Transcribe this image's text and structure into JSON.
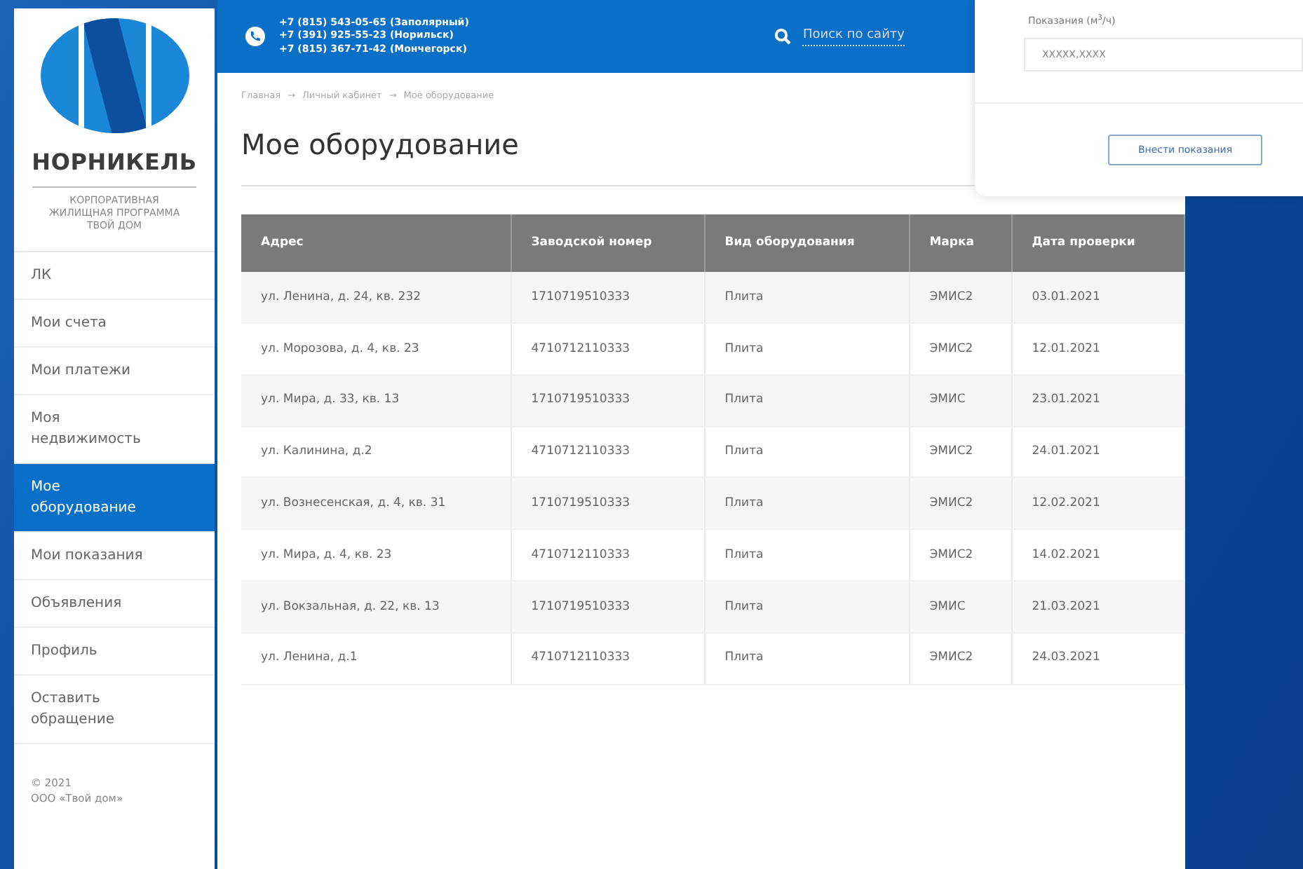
{
  "sidebar": {
    "brand": "НОРНИКЕЛЬ",
    "tagline": "КОРПОРАТИВНАЯ ЖИЛИЩНАЯ ПРОГРАММА ТВОЙ ДОМ",
    "items": [
      {
        "label": "ЛК",
        "selected": false
      },
      {
        "label": "Мои счета",
        "selected": false
      },
      {
        "label": "Мои платежи",
        "selected": false
      },
      {
        "label": "Моя недвижимость",
        "selected": false
      },
      {
        "label": "Мое оборудование",
        "selected": true
      },
      {
        "label": "Мои показания",
        "selected": false
      },
      {
        "label": "Объявления",
        "selected": false
      },
      {
        "label": "Профиль",
        "selected": false
      },
      {
        "label": "Оставить обращение",
        "selected": false
      }
    ],
    "footer": [
      "© 2021",
      "ООО «Твой дом»"
    ]
  },
  "header": {
    "phones": [
      "+7 (815) 543-05-65 (Заполярный)",
      "+7 (391) 925-55-23 (Норильск)",
      "+7 (815) 367-71-42 (Мончегорск)"
    ],
    "search": "Поиск по сайту"
  },
  "breadcrumb": {
    "separator": "→",
    "items": [
      "Главная",
      "Личный кабинет",
      "Мое оборудование"
    ]
  },
  "title": "Мое оборудование",
  "table": {
    "columns": [
      "Адрес",
      "Заводской номер",
      "Вид оборудования",
      "Марка",
      "Дата проверки"
    ],
    "rows": [
      [
        "ул. Ленина, д. 24, кв. 232",
        "1710719510333",
        "Плита",
        "ЭМИС2",
        "03.01.2021"
      ],
      [
        "ул. Морозова, д. 4, кв. 23",
        "4710712110333",
        "Плита",
        "ЭМИС2",
        "12.01.2021"
      ],
      [
        "ул. Мира, д. 33, кв. 13",
        "1710719510333",
        "Плита",
        "ЭМИС",
        "23.01.2021"
      ],
      [
        "ул. Калинина, д.2",
        "4710712110333",
        "Плита",
        "ЭМИС2",
        "24.01.2021"
      ],
      [
        "ул. Вознесенская, д. 4, кв. 31",
        "1710719510333",
        "Плита",
        "ЭМИС2",
        "12.02.2021"
      ],
      [
        "ул. Мира, д. 4, кв. 23",
        "4710712110333",
        "Плита",
        "ЭМИС2",
        "14.02.2021"
      ],
      [
        "ул. Вокзальная, д. 22, кв. 13",
        "1710719510333",
        "Плита",
        "ЭМИС",
        "21.03.2021"
      ],
      [
        "ул. Ленина, д.1",
        "4710712110333",
        "Плита",
        "ЭМИС2",
        "24.03.2021"
      ]
    ]
  },
  "reading_panel": {
    "label": "Показания (м$^{3}$/ч)",
    "placeholder": "XXXXX,XXXX",
    "button": "Внести показания"
  }
}
